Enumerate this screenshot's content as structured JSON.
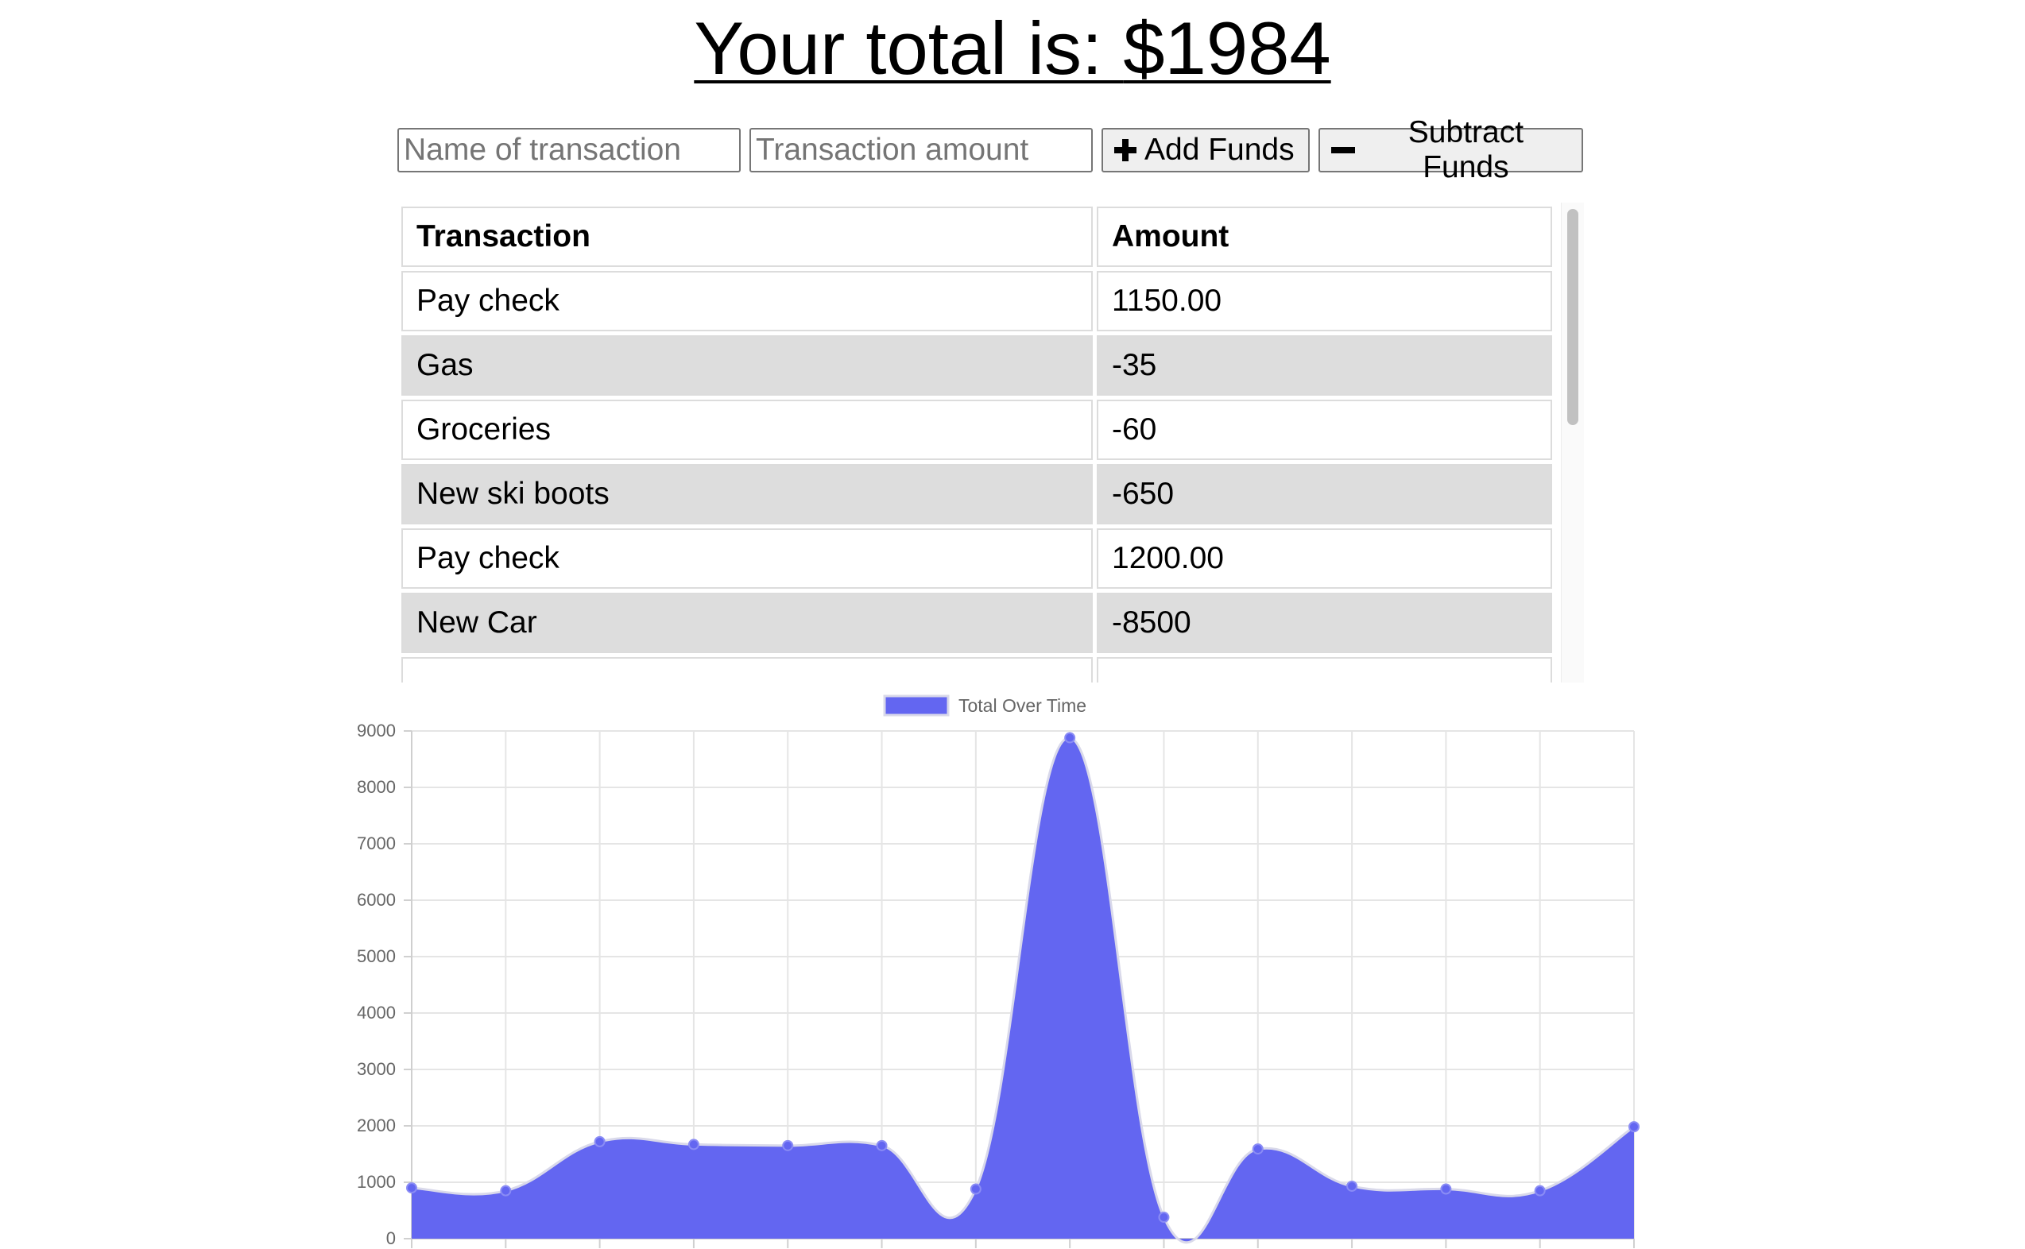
{
  "header": {
    "title_prefix": "Your total is: ",
    "title_amount": "$1984"
  },
  "form": {
    "name_placeholder": "Name of transaction",
    "amount_placeholder": "Transaction amount",
    "add_label": "Add Funds",
    "subtract_label": "Subtract Funds",
    "add_icon": "plus-icon",
    "subtract_icon": "minus-icon"
  },
  "table": {
    "headers": [
      "Transaction",
      "Amount"
    ],
    "rows": [
      {
        "name": "Pay check",
        "amount": "1150.00"
      },
      {
        "name": "Gas",
        "amount": "-35"
      },
      {
        "name": "Groceries",
        "amount": "-60"
      },
      {
        "name": "New ski boots",
        "amount": "-650"
      },
      {
        "name": "Pay check",
        "amount": "1200.00"
      },
      {
        "name": "New Car",
        "amount": "-8500"
      }
    ]
  },
  "chart_data": {
    "type": "area",
    "series": [
      {
        "name": "Total Over Time",
        "values": [
          900,
          850,
          1720,
          1670,
          1650,
          1650,
          880,
          8880,
          380,
          1590,
          930,
          880,
          850,
          1984
        ]
      }
    ],
    "ylim": [
      0,
      9000
    ],
    "y_ticks": [
      0,
      1000,
      2000,
      3000,
      4000,
      5000,
      6000,
      7000,
      8000,
      9000
    ],
    "grid": true,
    "legend_position": "top",
    "fill_color": "#6366f1",
    "line_color": "#d9d9ea"
  }
}
